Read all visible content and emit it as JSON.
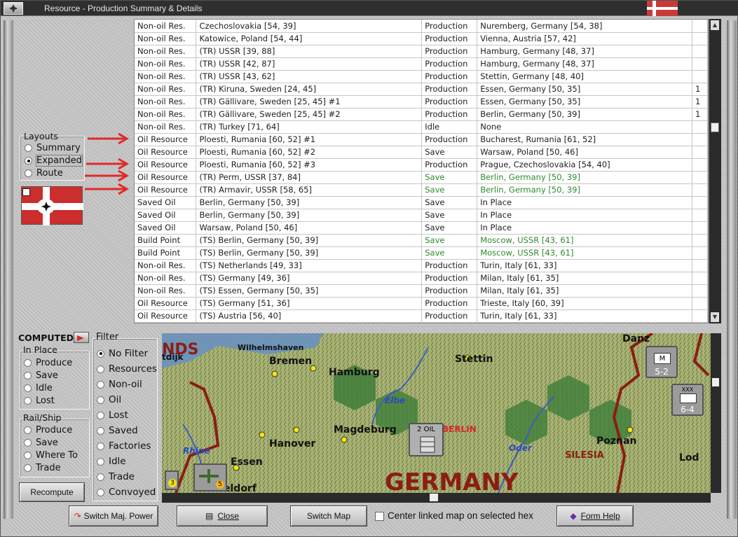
{
  "window": {
    "title": "Resource - Production Summary & Details"
  },
  "table": {
    "rows": [
      [
        "Non-oil Res.",
        "Czechoslovakia [54, 39]",
        "Production",
        "Nuremberg, Germany [54, 38]",
        "",
        false
      ],
      [
        "Non-oil Res.",
        "Katowice, Poland [54, 44]",
        "Production",
        "Vienna, Austria [57, 42]",
        "",
        false
      ],
      [
        "Non-oil Res.",
        "(TR) USSR [39, 88]",
        "Production",
        "Hamburg, Germany [48, 37]",
        "",
        false
      ],
      [
        "Non-oil Res.",
        "(TR) USSR [42, 87]",
        "Production",
        "Hamburg, Germany [48, 37]",
        "",
        false
      ],
      [
        "Non-oil Res.",
        "(TR) USSR [43, 62]",
        "Production",
        "Stettin, Germany [48, 40]",
        "",
        false
      ],
      [
        "Non-oil Res.",
        "(TR) Kiruna, Sweden [24, 45]",
        "Production",
        "Essen, Germany [50, 35]",
        "1",
        false
      ],
      [
        "Non-oil Res.",
        "(TR) Gällivare, Sweden [25, 45] #1",
        "Production",
        "Essen, Germany [50, 35]",
        "1",
        false
      ],
      [
        "Non-oil Res.",
        "(TR) Gällivare, Sweden [25, 45] #2",
        "Production",
        "Berlin, Germany [50, 39]",
        "1",
        false
      ],
      [
        "Non-oil Res.",
        "(TR) Turkey [71, 64]",
        "Idle",
        "None",
        "",
        false
      ],
      [
        "Oil Resource",
        "Ploesti, Rumania [60, 52] #1",
        "Production",
        "Bucharest, Rumania [61, 52]",
        "",
        false
      ],
      [
        "Oil Resource",
        "Ploesti, Rumania [60, 52] #2",
        "Save",
        "Warsaw, Poland [50, 46]",
        "",
        false
      ],
      [
        "Oil Resource",
        "Ploesti, Rumania [60, 52] #3",
        "Production",
        "Prague, Czechoslovakia [54, 40]",
        "",
        false
      ],
      [
        "Oil Resource",
        "(TR) Perm, USSR [37, 84]",
        "Save",
        "Berlin, Germany [50, 39]",
        "",
        true
      ],
      [
        "Oil Resource",
        "(TR) Armavir, USSR [58, 65]",
        "Save",
        "Berlin, Germany [50, 39]",
        "",
        true
      ],
      [
        "Saved Oil",
        "Berlin, Germany [50, 39]",
        "Save",
        "In Place",
        "",
        false
      ],
      [
        "Saved Oil",
        "Berlin, Germany [50, 39]",
        "Save",
        "In Place",
        "",
        false
      ],
      [
        "Saved Oil",
        "Warsaw, Poland [50, 46]",
        "Save",
        "In Place",
        "",
        false
      ],
      [
        "Build Point",
        "(TS) Berlin, Germany [50, 39]",
        "Save",
        "Moscow, USSR [43, 61]",
        "",
        true
      ],
      [
        "Build Point",
        "(TS) Berlin, Germany [50, 39]",
        "Save",
        "Moscow, USSR [43, 61]",
        "",
        true
      ],
      [
        "Non-oil Res.",
        "(TS) Netherlands [49, 33]",
        "Production",
        "Turin, Italy [61, 33]",
        "",
        false
      ],
      [
        "Non-oil Res.",
        "(TS) Germany [49, 36]",
        "Production",
        "Milan, Italy [61, 35]",
        "",
        false
      ],
      [
        "Non-oil Res.",
        "(TS) Essen, Germany [50, 35]",
        "Production",
        "Milan, Italy [61, 35]",
        "",
        false
      ],
      [
        "Oil Resource",
        "(TS) Germany [51, 36]",
        "Production",
        "Trieste, Italy [60, 39]",
        "",
        false
      ],
      [
        "Oil Resource",
        "(TS) Austria [56, 40]",
        "Production",
        "Turin, Italy [61, 33]",
        "",
        false
      ]
    ],
    "green_color": "#2f8a2f"
  },
  "layouts": {
    "label": "Layouts",
    "options": [
      "Summary",
      "Expanded",
      "Route"
    ],
    "selected": "Expanded"
  },
  "computed": {
    "label": "COMPUTED",
    "in_place": {
      "label": "In Place",
      "options": [
        "Produce",
        "Save",
        "Idle",
        "Lost"
      ]
    },
    "rail_ship": {
      "label": "Rail/Ship",
      "options": [
        "Produce",
        "Save",
        "Where To",
        "Trade"
      ]
    },
    "recompute": "Recompute"
  },
  "filter": {
    "label": "Filter",
    "options": [
      "No Filter",
      "Resources",
      "Non-oil",
      "Oil",
      "Lost",
      "Saved",
      "Factories",
      "Idle",
      "Trade",
      "Convoyed"
    ],
    "selected": "No Filter"
  },
  "map": {
    "labels": {
      "country": "GERMANY",
      "region": "SILESIA",
      "region_partial": "NDS",
      "cities": [
        "Wilhelmshaven",
        "Bremen",
        "Hamburg",
        "Stettin",
        "Magdeburg",
        "BERLIN",
        "Hanover",
        "Essen",
        "Poznan",
        "eldorf",
        "Danz",
        "Lod",
        "tdijk"
      ],
      "rivers": [
        "Elbe",
        "Rhine",
        "Oder"
      ]
    },
    "units": [
      {
        "top": "",
        "bottom": "5-2"
      },
      {
        "top": "XXX",
        "bottom": "6-4"
      }
    ],
    "oil_counter": "2 OIL",
    "badges": [
      "3",
      "5"
    ]
  },
  "footer": {
    "switch_power": "Switch Maj. Power",
    "close": "Close",
    "switch_map": "Switch Map",
    "center_linked": "Center linked map on selected hex",
    "form_help": "Form Help"
  },
  "colors": {
    "accent_red": "#d42a2a",
    "chrome": "#c3c3c3"
  }
}
